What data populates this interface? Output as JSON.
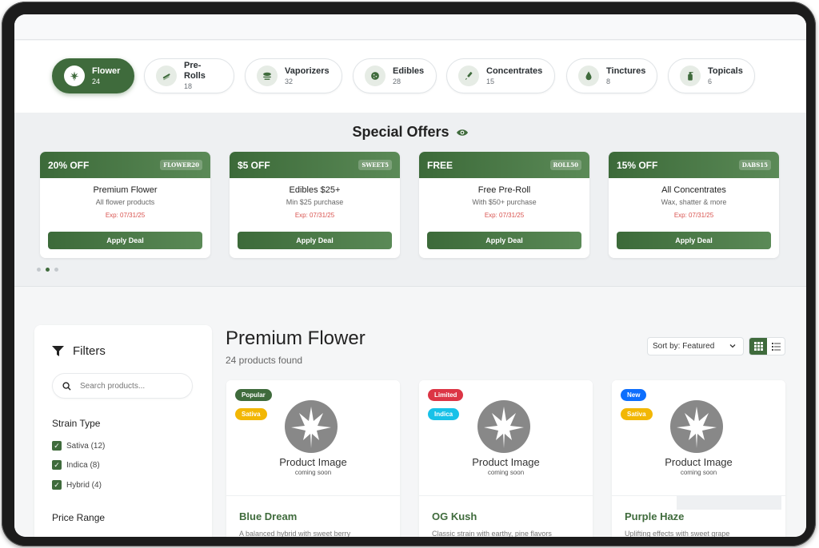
{
  "categories": [
    {
      "name": "Flower",
      "count": "24",
      "icon": "cannabis-leaf-icon",
      "active": true
    },
    {
      "name": "Pre-Rolls",
      "count": "18",
      "icon": "pre-roll-icon"
    },
    {
      "name": "Vaporizers",
      "count": "32",
      "icon": "vape-cloud-icon"
    },
    {
      "name": "Edibles",
      "count": "28",
      "icon": "cookie-icon"
    },
    {
      "name": "Concentrates",
      "count": "15",
      "icon": "dropper-icon"
    },
    {
      "name": "Tinctures",
      "count": "8",
      "icon": "droplet-icon"
    },
    {
      "name": "Topicals",
      "count": "6",
      "icon": "lotion-bottle-icon"
    }
  ],
  "offers": {
    "title": "Special Offers",
    "items": [
      {
        "discount": "20% OFF",
        "code": "FLOWER20",
        "name": "Premium Flower",
        "desc": "All flower products",
        "exp": "Exp: 07/31/25",
        "button": "Apply Deal"
      },
      {
        "discount": "$5 OFF",
        "code": "SWEET5",
        "name": "Edibles $25+",
        "desc": "Min $25 purchase",
        "exp": "Exp: 07/31/25",
        "button": "Apply Deal"
      },
      {
        "discount": "FREE",
        "code": "ROLL50",
        "name": "Free Pre-Roll",
        "desc": "With $50+ purchase",
        "exp": "Exp: 07/31/25",
        "button": "Apply Deal"
      },
      {
        "discount": "15% OFF",
        "code": "DABS15",
        "name": "All Concentrates",
        "desc": "Wax, shatter & more",
        "exp": "Exp: 07/31/25",
        "button": "Apply Deal"
      }
    ]
  },
  "filters": {
    "title": "Filters",
    "search_placeholder": "Search products...",
    "strain_title": "Strain Type",
    "strains": [
      "Sativa (12)",
      "Indica (8)",
      "Hybrid (4)"
    ],
    "price_title": "Price Range"
  },
  "listing": {
    "title": "Premium Flower",
    "count_text": "24 products found",
    "sort_label": "Sort by: Featured"
  },
  "products": [
    {
      "name": "Blue Dream",
      "desc": "A balanced hybrid with sweet berry",
      "badges": [
        {
          "text": "Popular",
          "color": "#3f6b3c"
        },
        {
          "text": "Sativa",
          "color": "#f2b705"
        }
      ]
    },
    {
      "name": "OG Kush",
      "desc": "Classic strain with earthy, pine flavors",
      "badges": [
        {
          "text": "Limited",
          "color": "#dc3545"
        },
        {
          "text": "Indica",
          "color": "#17c1e8"
        }
      ]
    },
    {
      "name": "Purple Haze",
      "desc": "Uplifting effects with sweet grape",
      "badges": [
        {
          "text": "New",
          "color": "#0d6efd"
        },
        {
          "text": "Sativa",
          "color": "#f2b705"
        }
      ]
    }
  ],
  "placeholder": {
    "title": "Product Image",
    "sub": "coming soon"
  },
  "colors": {
    "brand": "#3f6b3c",
    "expiry": "#d9534f"
  }
}
